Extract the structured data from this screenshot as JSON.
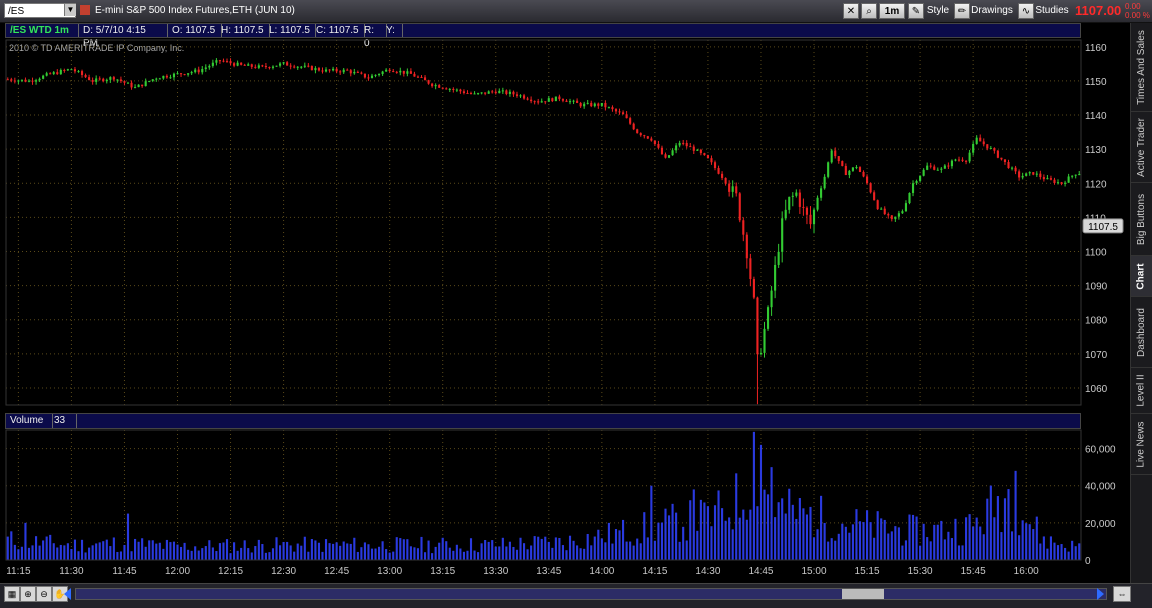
{
  "header": {
    "symbol": "/ES",
    "description": "E-mini S&P 500 Index Futures,ETH (JUN 10)",
    "interval_button": "1m",
    "style_button": "Style",
    "drawings_button": "Drawings",
    "studies_button": "Studies",
    "last_price": "1107.00",
    "change_line1": "0.00",
    "change_line2": "0.00 %"
  },
  "info": {
    "symbol": "/ES WTD 1m",
    "date": "D: 5/7/10 4:15 PM",
    "open": "O: 1107.5",
    "high": "H: 1107.5",
    "low": "L: 1107.5",
    "close": "C: 1107.5",
    "r": "R: 0",
    "y": "Y:"
  },
  "copyright": "2010 © TD AMERITRADE IP Company, Inc.",
  "volume_panel": {
    "label": "Volume",
    "value": "33"
  },
  "side_tabs": [
    "Times And Sales",
    "Active Trader",
    "Big Buttons",
    "Chart",
    "Dashboard",
    "Level II",
    "Live News"
  ],
  "colors": {
    "up": "#33cc33",
    "down": "#ee2222",
    "volume": "#2a3ae0",
    "grid": "#5a4a1a",
    "axis_text": "#c8a050",
    "background": "#000000"
  },
  "chart_data": [
    {
      "type": "candlestick",
      "title": "",
      "ylim": [
        1055,
        1162
      ],
      "y_ticks": [
        1060,
        1070,
        1080,
        1090,
        1100,
        1110,
        1120,
        1130,
        1140,
        1150,
        1160
      ],
      "y_tick_labels": [
        "1060",
        "1070",
        "1080",
        "1090",
        "1100",
        "1110",
        "1120",
        "1130",
        "1140",
        "1150",
        "1160"
      ],
      "last_price_marker": "1107.5",
      "grid": true,
      "x_ticks": [
        "11:15",
        "11:30",
        "11:45",
        "12:00",
        "12:15",
        "12:30",
        "12:45",
        "13:00",
        "13:15",
        "13:30",
        "13:45",
        "14:00",
        "14:15",
        "14:30",
        "14:45",
        "15:00",
        "15:15",
        "15:30",
        "15:45",
        "16:00"
      ],
      "first_bar_time": "11:12",
      "bar_interval_minutes": 1,
      "close_path_anchors": [
        [
          "11:12",
          1150.5
        ],
        [
          "11:18",
          1150
        ],
        [
          "11:24",
          1152
        ],
        [
          "11:30",
          1153.5
        ],
        [
          "11:36",
          1150
        ],
        [
          "11:42",
          1151
        ],
        [
          "11:48",
          1148
        ],
        [
          "11:54",
          1151
        ],
        [
          "12:00",
          1152
        ],
        [
          "12:06",
          1153
        ],
        [
          "12:12",
          1156
        ],
        [
          "12:18",
          1154.5
        ],
        [
          "12:24",
          1154
        ],
        [
          "12:30",
          1155
        ],
        [
          "12:36",
          1154
        ],
        [
          "12:42",
          1153
        ],
        [
          "12:48",
          1153
        ],
        [
          "12:54",
          1151
        ],
        [
          "13:00",
          1153.5
        ],
        [
          "13:06",
          1152
        ],
        [
          "13:12",
          1149
        ],
        [
          "13:18",
          1147.5
        ],
        [
          "13:24",
          1146
        ],
        [
          "13:30",
          1147
        ],
        [
          "13:36",
          1146
        ],
        [
          "13:42",
          1144
        ],
        [
          "13:48",
          1145
        ],
        [
          "13:54",
          1143
        ],
        [
          "14:00",
          1143
        ],
        [
          "14:06",
          1140
        ],
        [
          "14:10",
          1135
        ],
        [
          "14:14",
          1133
        ],
        [
          "14:18",
          1127
        ],
        [
          "14:22",
          1132
        ],
        [
          "14:26",
          1130
        ],
        [
          "14:30",
          1127
        ],
        [
          "14:34",
          1122
        ],
        [
          "14:38",
          1116
        ],
        [
          "14:41",
          1100
        ],
        [
          "14:43",
          1085
        ],
        [
          "14:44",
          1068
        ],
        [
          "14:45",
          1072
        ],
        [
          "14:47",
          1082
        ],
        [
          "14:49",
          1095
        ],
        [
          "14:51",
          1108
        ],
        [
          "14:53",
          1115
        ],
        [
          "14:55",
          1117
        ],
        [
          "14:57",
          1112
        ],
        [
          "14:59",
          1108
        ],
        [
          "15:01",
          1116
        ],
        [
          "15:03",
          1122
        ],
        [
          "15:05",
          1130
        ],
        [
          "15:07",
          1126
        ],
        [
          "15:09",
          1123
        ],
        [
          "15:12",
          1125
        ],
        [
          "15:15",
          1120
        ],
        [
          "15:18",
          1113
        ],
        [
          "15:22",
          1109
        ],
        [
          "15:25",
          1112
        ],
        [
          "15:28",
          1120
        ],
        [
          "15:32",
          1125
        ],
        [
          "15:36",
          1124
        ],
        [
          "15:40",
          1127
        ],
        [
          "15:43",
          1127
        ],
        [
          "15:46",
          1133
        ],
        [
          "15:50",
          1130
        ],
        [
          "15:54",
          1126
        ],
        [
          "15:58",
          1122
        ],
        [
          "16:02",
          1123
        ],
        [
          "16:06",
          1121
        ],
        [
          "16:10",
          1120
        ],
        [
          "16:14",
          1123
        ]
      ]
    },
    {
      "type": "bar",
      "title": "Volume",
      "ylim": [
        0,
        70000
      ],
      "y_ticks": [
        0,
        20000,
        40000,
        60000
      ],
      "y_tick_labels": [
        "0",
        "20,000",
        "40,000",
        "60,000"
      ],
      "volume_path_anchors": [
        [
          "11:12",
          12000
        ],
        [
          "11:30",
          9000
        ],
        [
          "11:45",
          10000
        ],
        [
          "12:00",
          8000
        ],
        [
          "12:30",
          9000
        ],
        [
          "13:00",
          9000
        ],
        [
          "13:30",
          9000
        ],
        [
          "13:50",
          11000
        ],
        [
          "14:05",
          16000
        ],
        [
          "14:20",
          22000
        ],
        [
          "14:32",
          26000
        ],
        [
          "14:40",
          38000
        ],
        [
          "14:43",
          62000
        ],
        [
          "14:46",
          42000
        ],
        [
          "14:50",
          30000
        ],
        [
          "15:00",
          26000
        ],
        [
          "15:15",
          20000
        ],
        [
          "15:30",
          17000
        ],
        [
          "15:45",
          20000
        ],
        [
          "15:55",
          40000
        ],
        [
          "16:05",
          12000
        ],
        [
          "16:14",
          8000
        ]
      ],
      "volume_peaks": [
        [
          "11:17",
          20000
        ],
        [
          "11:46",
          25000
        ],
        [
          "14:14",
          40000
        ],
        [
          "14:26",
          38000
        ],
        [
          "14:43",
          69000
        ],
        [
          "14:45",
          62000
        ],
        [
          "14:48",
          50000
        ],
        [
          "15:57",
          48000
        ]
      ]
    }
  ]
}
